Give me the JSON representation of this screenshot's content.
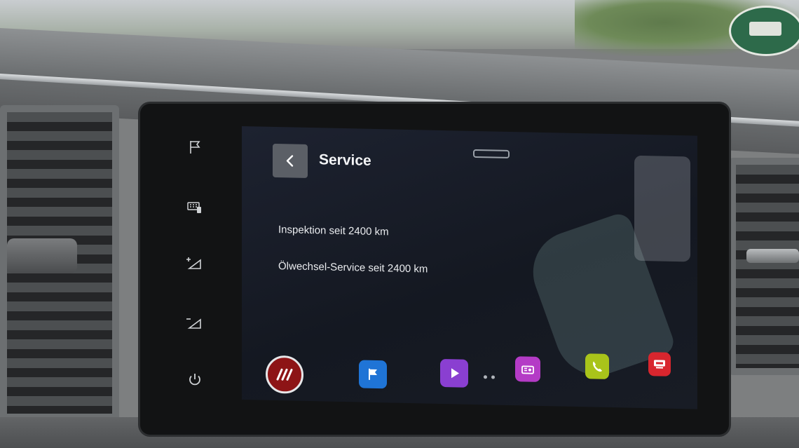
{
  "screen": {
    "title": "Service",
    "lines": [
      "Inspektion seit 2400 km",
      "Ölwechsel-Service seit 2400 km"
    ]
  },
  "icons": {
    "back": "chevron-left-icon",
    "side_buttons": [
      "flag-icon",
      "keyboard-icon",
      "brightness-up-icon",
      "brightness-down-icon",
      "power-icon"
    ],
    "dock": [
      "brand-logo-icon",
      "navigation-icon",
      "media-icon",
      "radio-icon",
      "phone-icon",
      "car-icon"
    ]
  },
  "colors": {
    "navigation": "#1f74d6",
    "media": "#8a3fd1",
    "radio": "#b43bc6",
    "phone": "#a9c41a",
    "car": "#d8262e",
    "brand_ring": "#e6e7e9"
  },
  "pagination": {
    "pages": 2,
    "current": 1
  }
}
